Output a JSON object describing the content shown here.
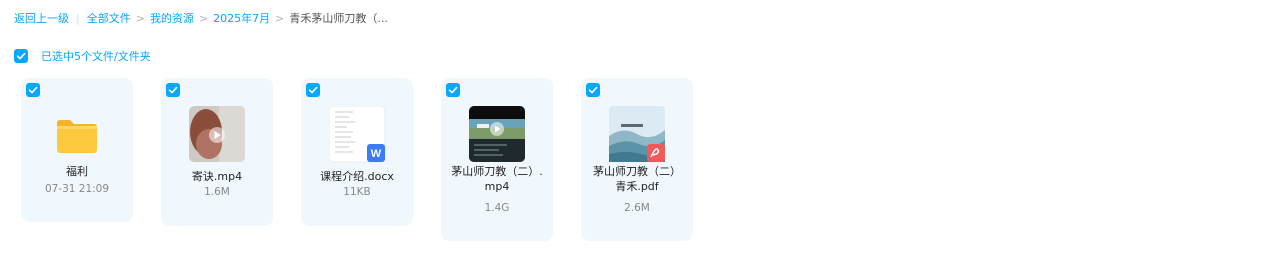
{
  "breadcrumb": {
    "back": "返回上一级",
    "items": [
      "全部文件",
      "我的资源",
      "2025年7月"
    ],
    "current": "青禾茅山师刀教（..."
  },
  "selection": {
    "label": "已选中5个文件/文件夹"
  },
  "files": [
    {
      "name": "福利",
      "meta": "07-31 21:09",
      "type": "folder",
      "checked": true
    },
    {
      "name": "寄诀.mp4",
      "meta": "1.6M",
      "type": "video",
      "checked": true
    },
    {
      "name": "课程介绍.docx",
      "meta": "11KB",
      "type": "docx",
      "checked": true
    },
    {
      "name_line1": "茅山师刀教（二）.",
      "name_line2": "mp4",
      "meta": "1.4G",
      "type": "video",
      "checked": true
    },
    {
      "name_line1": "茅山师刀教（二）",
      "name_line2": "青禾.pdf",
      "meta": "2.6M",
      "type": "pdf",
      "checked": true
    }
  ],
  "colors": {
    "accent": "#06a7ff",
    "card_bg": "#f0f8fd",
    "folder": "#fcc93c",
    "docx_badge": "#3b7bf5",
    "pdf_badge": "#f25a5a"
  }
}
